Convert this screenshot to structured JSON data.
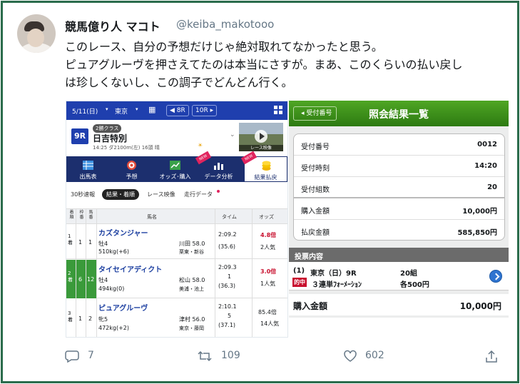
{
  "tweet": {
    "display_name": "競馬億り人 マコト",
    "handle": "@keiba_makotooo",
    "text_lines": [
      "このレース、自分の予想だけじゃ絶対取れてなかったと思う。",
      "ピュアグルーヴを押さえてたのは本当にさすが。まあ、このくらいの払い戻し",
      "は珍しくないし、この調子でどんどん行く。"
    ]
  },
  "race_app": {
    "date": "5/11(日)",
    "venue": "東京",
    "prev_race": "◀ 8R",
    "next_race": "10R ▸",
    "race_no": "9R",
    "class": "2勝クラス",
    "race_name": "日吉特別",
    "race_info": "14:25 ダ2100m(左) 16頭 晴",
    "video_label": "レース映像",
    "nav": [
      "出馬表",
      "予想",
      "オッズ･購入",
      "データ分析",
      "結果払戻"
    ],
    "new_badge": "NEW",
    "subtabs": [
      "30秒速報",
      "結果・着順",
      "レース映像",
      "走行データ"
    ],
    "headers": {
      "rank": "着順",
      "frame": "枠番",
      "horse_no": "馬番",
      "name": "馬名",
      "time": "タイム",
      "odds": "オッズ"
    },
    "rows": [
      {
        "rank": "1着",
        "frame": "1",
        "horse_no": "1",
        "name": "カズタンジャー",
        "sexage": "牡4",
        "weight": "510kg(+6)",
        "jockey": "川田 58.0",
        "stable": "栗東・新谷",
        "time": "2:09.2",
        "margin": "",
        "last3f": "(35.6)",
        "odds": "4.8倍",
        "pop": "2人気"
      },
      {
        "rank": "2着",
        "frame": "6",
        "horse_no": "12",
        "name": "タイセイアディクト",
        "sexage": "牡4",
        "weight": "494kg(0)",
        "jockey": "松山 58.0",
        "stable": "美浦・池上",
        "time": "2:09.3",
        "margin": "1",
        "last3f": "(36.3)",
        "odds": "3.0倍",
        "pop": "1人気"
      },
      {
        "rank": "3着",
        "frame": "1",
        "horse_no": "2",
        "name": "ピュアグルーヴ",
        "sexage": "牝5",
        "weight": "472kg(+2)",
        "jockey": "津村 56.0",
        "stable": "東京・藤岡",
        "time": "2:10.1",
        "margin": "5",
        "last3f": "(37.1)",
        "odds": "85.4倍",
        "pop": "14人気"
      }
    ]
  },
  "receipt": {
    "back_button": "受付番号",
    "title": "照会結果一覧",
    "fields": [
      {
        "label": "受付番号",
        "value": "0012"
      },
      {
        "label": "受付時刻",
        "value": "14:20"
      },
      {
        "label": "受付組数",
        "value": "20"
      },
      {
        "label": "購入金額",
        "value": "10,000円"
      },
      {
        "label": "払戻金額",
        "value": "585,850円"
      }
    ],
    "section_title": "投票内容",
    "bet_no": "(1)",
    "bet_venue": "東京（日）9R",
    "bet_count": "20組",
    "hit_badge": "的中",
    "bet_type": "３連単ﾌｫｰﾒｰｼｮﾝ",
    "bet_each": "各500円",
    "total_label": "購入金額",
    "total_value": "10,000円"
  },
  "actions": {
    "reply_count": "7",
    "retweet_count": "109",
    "like_count": "602"
  },
  "colors": {
    "frame": "#2a6b4b",
    "app_blue": "#1f3fae",
    "green": "#3a8f1a",
    "red": "#c8102e"
  }
}
